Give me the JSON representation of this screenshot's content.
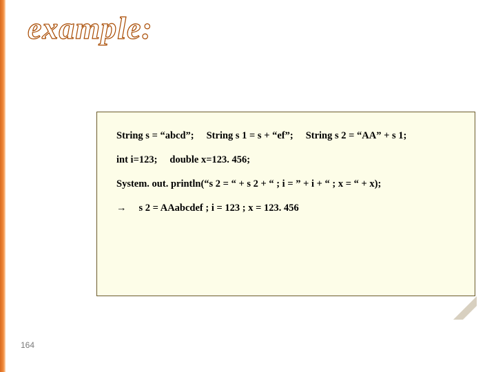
{
  "title": "example:",
  "code": {
    "line1a": "String s = “abcd”;",
    "line1b": "String s 1 = s + “ef”;",
    "line1c": "String s 2 = “AA” + s 1;",
    "line2a": "int i=123;",
    "line2b": "double x=123. 456;",
    "line3": "System. out. println(“s 2 = “ + s 2 + “ ; i = ” + i + “ ; x = “ + x);",
    "arrow": "→",
    "line4b": "s 2 = AAabcdef ; i = 123 ; x = 123. 456"
  },
  "pageNumber": "164"
}
